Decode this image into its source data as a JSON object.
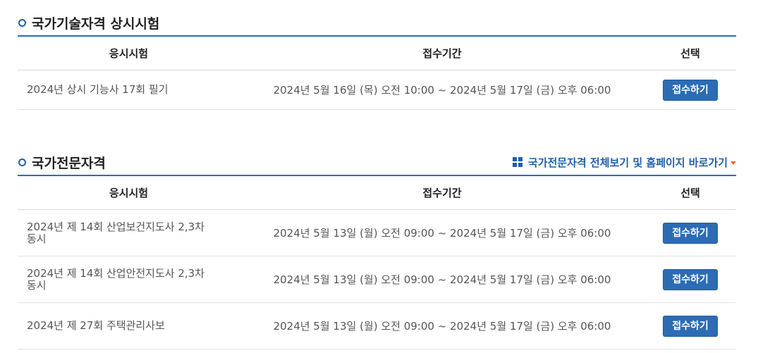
{
  "section1": {
    "title": "국가기술자격 상시시험",
    "headers": {
      "exam": "응시시험",
      "period": "접수기간",
      "select": "선택"
    },
    "rows": [
      {
        "exam": "2024년 상시 기능사 17회 필기",
        "period": "2024년 5월 16일 (목) 오전 10:00 ~ 2024년 5월 17일 (금) 오후 06:00",
        "button": "접수하기"
      }
    ]
  },
  "section2": {
    "title": "국가전문자격",
    "more_link": "국가전문자격 전체보기 및 홈페이지 바로가기",
    "headers": {
      "exam": "응시시험",
      "period": "접수기간",
      "select": "선택"
    },
    "rows": [
      {
        "exam_line1": "2024년 제 14회 산업보건지도사 2,3차",
        "exam_line2": "동시",
        "period": "2024년 5월 13일 (월) 오전 09:00 ~ 2024년 5월 17일 (금) 오후 06:00",
        "button": "접수하기"
      },
      {
        "exam_line1": "2024년 제 14회 산업안전지도사 2,3차",
        "exam_line2": "동시",
        "period": "2024년 5월 13일 (월) 오전 09:00 ~ 2024년 5월 17일 (금) 오후 06:00",
        "button": "접수하기"
      },
      {
        "exam_line1": "2024년 제 27회 주택관리사보",
        "exam_line2": "",
        "period": "2024년 5월 13일 (월) 오전 09:00 ~ 2024년 5월 17일 (금) 오후 06:00",
        "button": "접수하기"
      }
    ]
  },
  "colors": {
    "accent": "#2b6cb5",
    "caret": "#f26b1d"
  },
  "icons": [
    "circle-bullet-icon",
    "grid-icon",
    "caret-down-icon"
  ]
}
